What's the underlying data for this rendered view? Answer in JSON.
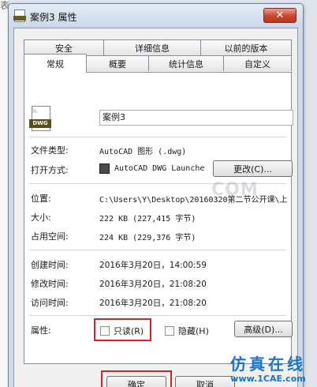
{
  "window": {
    "title": "案例3 属性",
    "close_glyph": "✕"
  },
  "tabs_back": [
    "安全",
    "详细信息",
    "以前的版本"
  ],
  "tabs_front": [
    "常规",
    "概要",
    "统计信息",
    "自定义"
  ],
  "general": {
    "file_icon": "dwg-file-icon",
    "file_icon_text": "DWG",
    "name_value": "案例3",
    "file_type_label": "文件类型:",
    "file_type_value": "AutoCAD 图形 (.dwg)",
    "open_with_label": "打开方式:",
    "open_with_value": "AutoCAD DWG Launche",
    "change_button": "更改(C)...",
    "location_label": "位置:",
    "location_value": "C:\\Users\\Y\\Desktop\\20160320第二节公开课\\上",
    "size_label": "大小:",
    "size_value": "222 KB (227,415 字节)",
    "disk_size_label": "占用空间:",
    "disk_size_value": "224 KB (229,376 字节)",
    "created_label": "创建时间:",
    "created_value": "2016年3月20日，14:00:59",
    "modified_label": "修改时间:",
    "modified_value": "2016年3月20日，21:08:20",
    "accessed_label": "访问时间:",
    "accessed_value": "2016年3月20日，21:08:20",
    "attributes_label": "属性:",
    "readonly_label": "只读(R)",
    "hidden_label": "隐藏(H)",
    "advanced_button": "高级(D)..."
  },
  "footer": {
    "ok_button": "确定",
    "cancel_button": "取消"
  },
  "watermark": "COM",
  "brand": {
    "top": "仿真在线",
    "bottom": "www.1CAE.com"
  },
  "edge_char": "表",
  "colors": {
    "highlight": "#d9202a",
    "brand": "#1b75c9",
    "close": "#c9452c"
  }
}
